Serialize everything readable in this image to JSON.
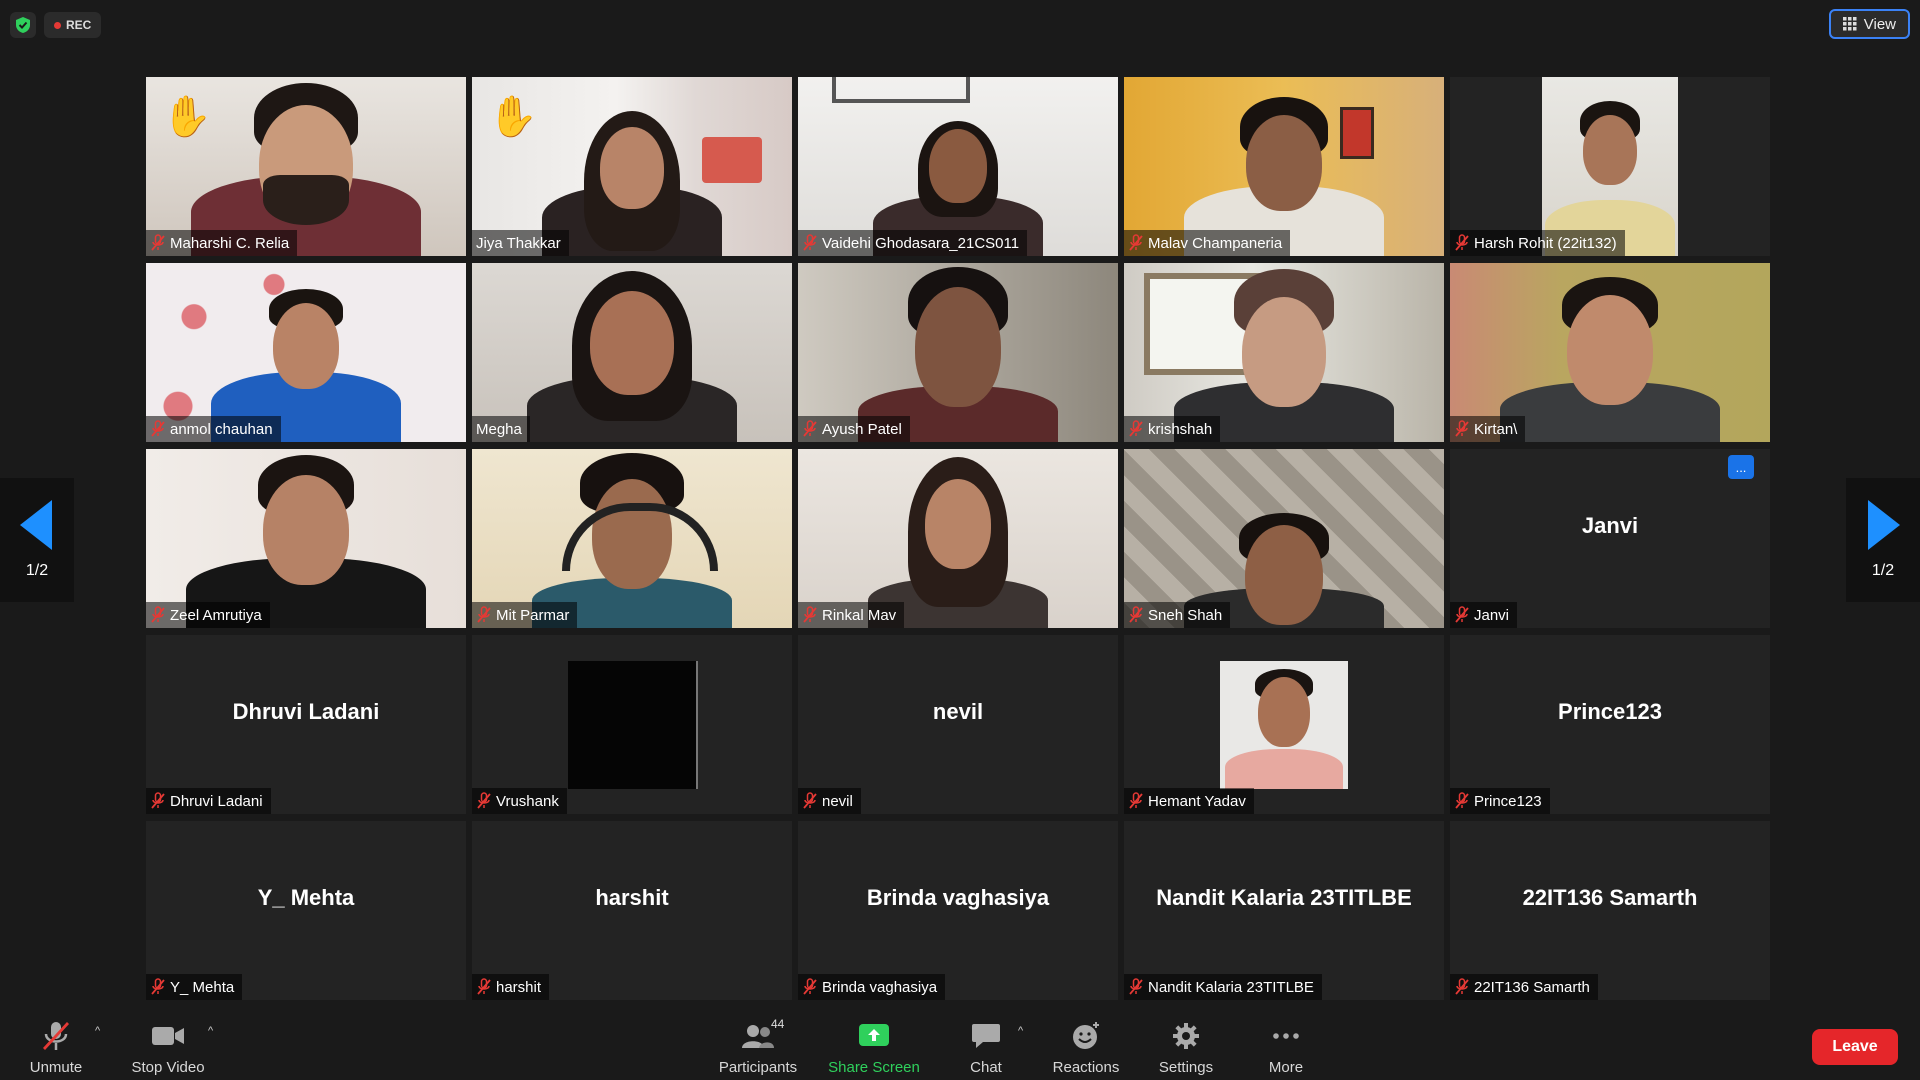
{
  "topbar": {
    "rec_label": "REC",
    "view_label": "View"
  },
  "pager": {
    "left_label": "1/2",
    "right_label": "1/2"
  },
  "tiles": [
    {
      "name": "Maharshi C. Relia",
      "raised_hand": true,
      "muted": true
    },
    {
      "name": "Jiya Thakkar",
      "raised_hand": true,
      "muted": false,
      "active_speaker": true
    },
    {
      "name": "Vaidehi Ghodasara_21CS011",
      "muted": true
    },
    {
      "name": "Malav Champaneria",
      "muted": true
    },
    {
      "name": "Harsh Rohit (22it132)",
      "muted": true
    },
    {
      "name": "anmol chauhan",
      "muted": true
    },
    {
      "name": "Megha",
      "muted": false
    },
    {
      "name": "Ayush Patel",
      "muted": true
    },
    {
      "name": "krishshah",
      "muted": true
    },
    {
      "name": "Kirtan\\",
      "muted": true
    },
    {
      "name": "Zeel Amrutiya",
      "muted": true
    },
    {
      "name": "Mit Parmar",
      "muted": true
    },
    {
      "name": "Rinkal Mav",
      "muted": true
    },
    {
      "name": "Sneh Shah",
      "muted": true
    },
    {
      "name": "Janvi",
      "display": "Janvi",
      "muted": true,
      "more_button": "..."
    },
    {
      "name": "Dhruvi Ladani",
      "display": "Dhruvi Ladani",
      "muted": true
    },
    {
      "name": "Vrushank",
      "muted": true
    },
    {
      "name": "nevil",
      "display": "nevil",
      "muted": true
    },
    {
      "name": "Hemant Yadav",
      "muted": true
    },
    {
      "name": "Prince123",
      "display": "Prince123",
      "muted": true
    },
    {
      "name": "Y_ Mehta",
      "display": "Y_ Mehta",
      "muted": true
    },
    {
      "name": "harshit",
      "display": "harshit",
      "muted": true
    },
    {
      "name": "Brinda vaghasiya",
      "display": "Brinda vaghasiya",
      "muted": true
    },
    {
      "name": "Nandit Kalaria 23TITLBE",
      "display": "Nandit Kalaria 23TITLBE",
      "muted": true
    },
    {
      "name": "22IT136 Samarth",
      "display": "22IT136 Samarth",
      "muted": true
    }
  ],
  "toolbar": {
    "unmute_label": "Unmute",
    "stop_video_label": "Stop Video",
    "participants_label": "Participants",
    "participants_count": "44",
    "share_screen_label": "Share Screen",
    "chat_label": "Chat",
    "reactions_label": "Reactions",
    "settings_label": "Settings",
    "more_label": "More",
    "leave_label": "Leave"
  },
  "colors": {
    "active_speaker": "#b5d96a",
    "share_green": "#2fd05c",
    "leave_red": "#e5262a",
    "mute_red": "#e53935"
  }
}
